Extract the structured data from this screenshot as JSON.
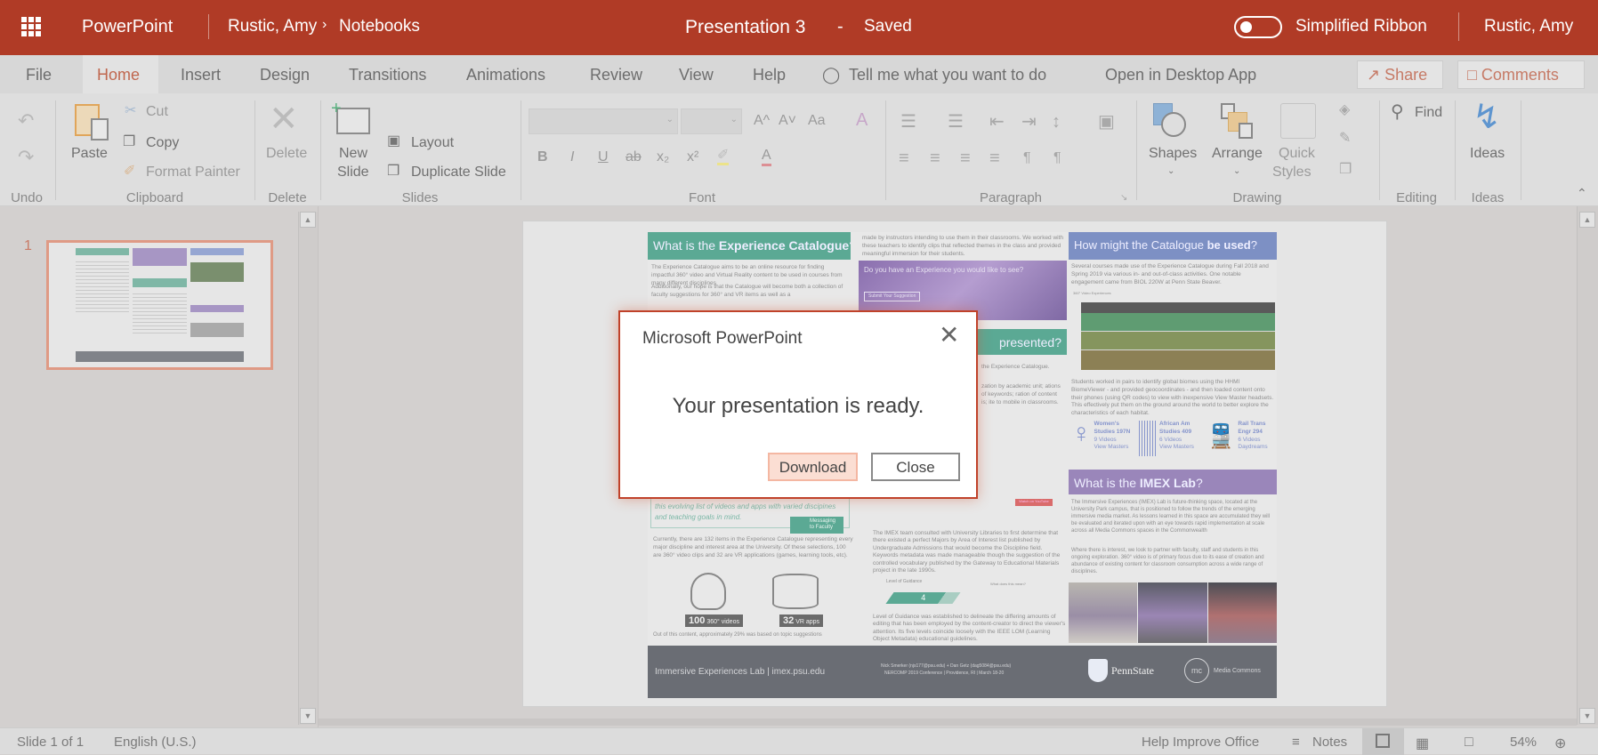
{
  "titlebar": {
    "app": "PowerPoint",
    "breadcrumb_user": "Rustic, Amy",
    "breadcrumb_sep": "›",
    "breadcrumb_folder": "Notebooks",
    "doc_title": "Presentation 3",
    "dash": "-",
    "save_status": "Saved",
    "simplified_ribbon": "Simplified Ribbon",
    "simplified_ribbon_on": false,
    "user": "Rustic, Amy",
    "color": "#b03b26"
  },
  "tabs": {
    "items": [
      "File",
      "Home",
      "Insert",
      "Design",
      "Transitions",
      "Animations",
      "Review",
      "View",
      "Help"
    ],
    "active": "Home",
    "tell_me": "Tell me what you want to do",
    "open_desktop": "Open in Desktop App",
    "share": "Share",
    "comments": "Comments"
  },
  "ribbon": {
    "undo_label": "Undo",
    "clipboard": {
      "paste": "Paste",
      "cut": "Cut",
      "copy": "Copy",
      "format_painter": "Format Painter",
      "label": "Clipboard"
    },
    "delete": {
      "button": "Delete",
      "label": "Delete"
    },
    "slides": {
      "new1": "New",
      "new2": "Slide",
      "layout": "Layout",
      "duplicate": "Duplicate Slide",
      "label": "Slides"
    },
    "font": {
      "label": "Font",
      "bold": "B",
      "italic": "I",
      "underline": "U",
      "strike": "ab",
      "sub": "x₂",
      "sup": "x²",
      "grow": "A^",
      "shrink": "A˅",
      "case": "Aa",
      "color": "A"
    },
    "paragraph": {
      "label": "Paragraph"
    },
    "drawing": {
      "shapes": "Shapes",
      "arrange": "Arrange",
      "quick1": "Quick",
      "quick2": "Styles",
      "label": "Drawing"
    },
    "editing": {
      "find": "Find",
      "label": "Editing"
    },
    "ideas": {
      "button": "Ideas",
      "label": "Ideas"
    }
  },
  "thumbnails": [
    {
      "number": "1"
    }
  ],
  "poster": {
    "h1a": "What is the ",
    "h1b": "Experience Catalogue",
    "h1c": "?",
    "p1": "The Experience Catalogue aims to be an online resource for finding impactful 360° video and Virtual Reality content to be used in courses from many different disciplines",
    "p2": "Additionally, our hope is that the Catalogue will become both a collection of faculty suggestions for 360° and VR items as well as a",
    "col2_top": "made by instructors intending to use them in their classrooms. We worked with these teachers to identify clips that reflected themes in the class and provided meaningful immersion for their students.",
    "suggest_title": "Do you have an Experience you would like to see?",
    "suggest_btn": "Submit Your Suggestion",
    "h2": "presented?",
    "col2_mid": "the Experience Catalogue.",
    "col2_mid2": "zation by academic unit; ations of keywords; ration of content is; ite to mobile in classrooms.",
    "quote": "this evolving list of videos and apps with varied discipines and teaching goals in mind.",
    "messaging": "Messaging to Faculty",
    "p3": "Currently, there are 132 items in the Experience Catalogue representing every major discipline and interest area at the University. Of these selections, 100 are 360° video clips and 32 are VR applications (games, learning tools, etc).",
    "stat1_num": "100",
    "stat1_lbl": "360° videos",
    "stat2_num": "32",
    "stat2_lbl": "VR apps",
    "p4": "Out of this content, approximately 29% was based on topic suggestions",
    "watch": "Watch on YouTube",
    "p5": "The IMEX team consulted with University Libraries to first determine that there existed a perfect Majors by Area of Interest list published by Undergraduate Admissions that would become the Discipline field. Keywords metadata was made manageable though the suggestion of the controlled vocabulary published by the Gateway to Educational Materials project in the late 1990s.",
    "log_title": "Level of Guidance",
    "log_level": "4",
    "log_q": "What does this mean?",
    "p6": "Level of Guidance was established to delineate the differing amounts of editing that has been employed by the content-creator to direct the viewer's attention. Its five levels coincide loosely with the IEEE LOM (Learning Object Metadata) educational guidelines.",
    "h3a": "How might the Catalogue ",
    "h3b": "be used",
    "h3c": "?",
    "p7": "Several courses made use of the Experience Catalogue during Fall 2018 and Spring 2019 via various in- and out-of-class activities. One notable engagement came from BIOL 220W at Penn State Beaver.",
    "table_caption": "360° Video Experiences",
    "p8": "Students worked in pairs to identify global biomes using the HHMI BiomeViewer - and provided geocoordinates - and then loaded content onto their phones (using QR codes) to view with inexpensive View Master headsets. This effectively put them on the ground around the world to better explore the characteristics of each habitat.",
    "courses": [
      {
        "name": "Women's Studies 197N",
        "count": "9 Videos",
        "device": "View Masters"
      },
      {
        "name": "African Am Studies 409",
        "count": "6 Videos",
        "device": "View Masters"
      },
      {
        "name": "Rail Trans Engr 294",
        "count": "6 Videos",
        "device": "Daydreams"
      }
    ],
    "h4a": "What is the ",
    "h4b": "IMEX Lab",
    "h4c": "?",
    "p9": "The Immersive Experiences (IMEX) Lab is future-thinking space, located at the University Park campus, that is positioned to follow the trends of the emerging immersive media market. As lessons learned in this space are accumulated they will be evaluated and iterated upon with an eye towards rapid implementation at scale across all Media Commons spaces in the Commonwealth",
    "p10": "Where there is interest, we look to partner with faculty, staff and students in this ongoing exploration. 360° video is of primary focus due to its ease of creation and abundance of existing content for classroom consumption across a wide range of disciplines.",
    "footer_left": "Immersive Experiences Lab  |  imex.psu.edu",
    "footer_mid1": "Nick Smerker (njs177@psu.edu) + Dan Getz (dag5084@psu.edu)",
    "footer_mid2": "NERCOMP 2019 Conference  |  Providence, RI  |  March 18-20",
    "pennstate": "PennState",
    "media_commons": "Media Commons",
    "colors": {
      "green": "#5ba994",
      "blue": "#7d90c4",
      "purple": "#9a86ba",
      "footer": "#6a6d74"
    }
  },
  "dialog": {
    "title": "Microsoft PowerPoint",
    "message": "Your presentation is ready.",
    "download": "Download",
    "close": "Close"
  },
  "status": {
    "slide": "Slide 1 of 1",
    "language": "English (U.S.)",
    "help": "Help Improve Office",
    "notes": "Notes",
    "zoom": "54%"
  }
}
